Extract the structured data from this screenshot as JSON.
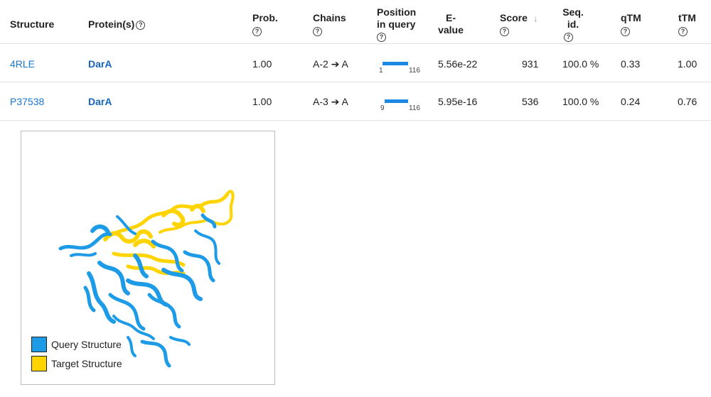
{
  "table": {
    "headers": {
      "structure": "Structure",
      "proteins": "Protein(s)",
      "prob": "Prob.",
      "chains": "Chains",
      "position_line1": "Position",
      "position_line2": "in query",
      "evalue_line1": "E-",
      "evalue_line2": "value",
      "score": "Score",
      "seqid_line1": "Seq.",
      "seqid_line2": "id.",
      "qtm": "qTM",
      "ttm": "tTM"
    },
    "help_glyph": "?",
    "sort_glyph": "↓",
    "rows": [
      {
        "structure": "4RLE",
        "protein": "DarA",
        "prob": "1.00",
        "chains": "A-2 ➔ A",
        "pos_start": "1",
        "pos_end": "116",
        "pos_fraction_start": 0.0,
        "pos_fraction_end": 1.0,
        "evalue": "5.56e-22",
        "score": "931",
        "seqid": "100.0 %",
        "qtm": "0.33",
        "ttm": "1.00"
      },
      {
        "structure": "P37538",
        "protein": "DarA",
        "prob": "1.00",
        "chains": "A-3 ➔ A",
        "pos_start": "9",
        "pos_end": "116",
        "pos_fraction_start": 0.07,
        "pos_fraction_end": 1.0,
        "evalue": "5.95e-16",
        "score": "536",
        "seqid": "100.0 %",
        "qtm": "0.24",
        "ttm": "0.76"
      }
    ]
  },
  "viewer": {
    "legend": {
      "query_label": "Query Structure",
      "target_label": "Target Structure",
      "query_color": "#1e9be6",
      "target_color": "#ffd400"
    }
  }
}
